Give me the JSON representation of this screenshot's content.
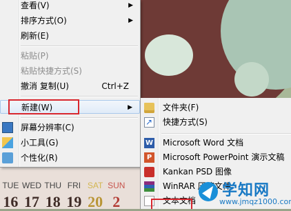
{
  "calendar": {
    "days": [
      "TUE",
      "WED",
      "THU",
      "FRI",
      "SAT",
      "SUN"
    ],
    "dates": [
      "16",
      "17",
      "18",
      "19",
      "20",
      "2"
    ]
  },
  "context_menu": {
    "items": [
      {
        "label": "查看(V)",
        "has_submenu": true
      },
      {
        "label": "排序方式(O)",
        "has_submenu": true
      },
      {
        "label": "刷新(E)"
      },
      {
        "label": "粘贴(P)",
        "disabled": true
      },
      {
        "label": "粘贴快捷方式(S)",
        "disabled": true
      },
      {
        "label": "撤消 复制(U)",
        "shortcut": "Ctrl+Z"
      },
      {
        "label": "新建(W)",
        "has_submenu": true,
        "highlighted": true
      },
      {
        "label": "屏幕分辨率(C)",
        "icon": "screen-resolution-icon"
      },
      {
        "label": "小工具(G)",
        "icon": "gadgets-icon"
      },
      {
        "label": "个性化(R)",
        "icon": "personalize-icon"
      }
    ]
  },
  "new_submenu": {
    "items": [
      {
        "label": "文件夹(F)",
        "icon": "folder-icon"
      },
      {
        "label": "快捷方式(S)",
        "icon": "shortcut-icon"
      },
      {
        "label": "Microsoft Word 文档",
        "icon": "word-icon"
      },
      {
        "label": "Microsoft PowerPoint 演示文稿",
        "icon": "powerpoint-icon"
      },
      {
        "label": "Kankan PSD 图像",
        "icon": "psd-icon"
      },
      {
        "label": "WinRAR 压缩文件",
        "icon": "winrar-icon"
      },
      {
        "label": "文本文档",
        "icon": "text-document-icon"
      }
    ]
  },
  "watermark": {
    "title": "学知网",
    "url": "www.jmqz1000.com"
  },
  "colors": {
    "highlight_box": "#d8262d",
    "menu_background": "#f0f0f0",
    "watermark": "#1979c4"
  }
}
